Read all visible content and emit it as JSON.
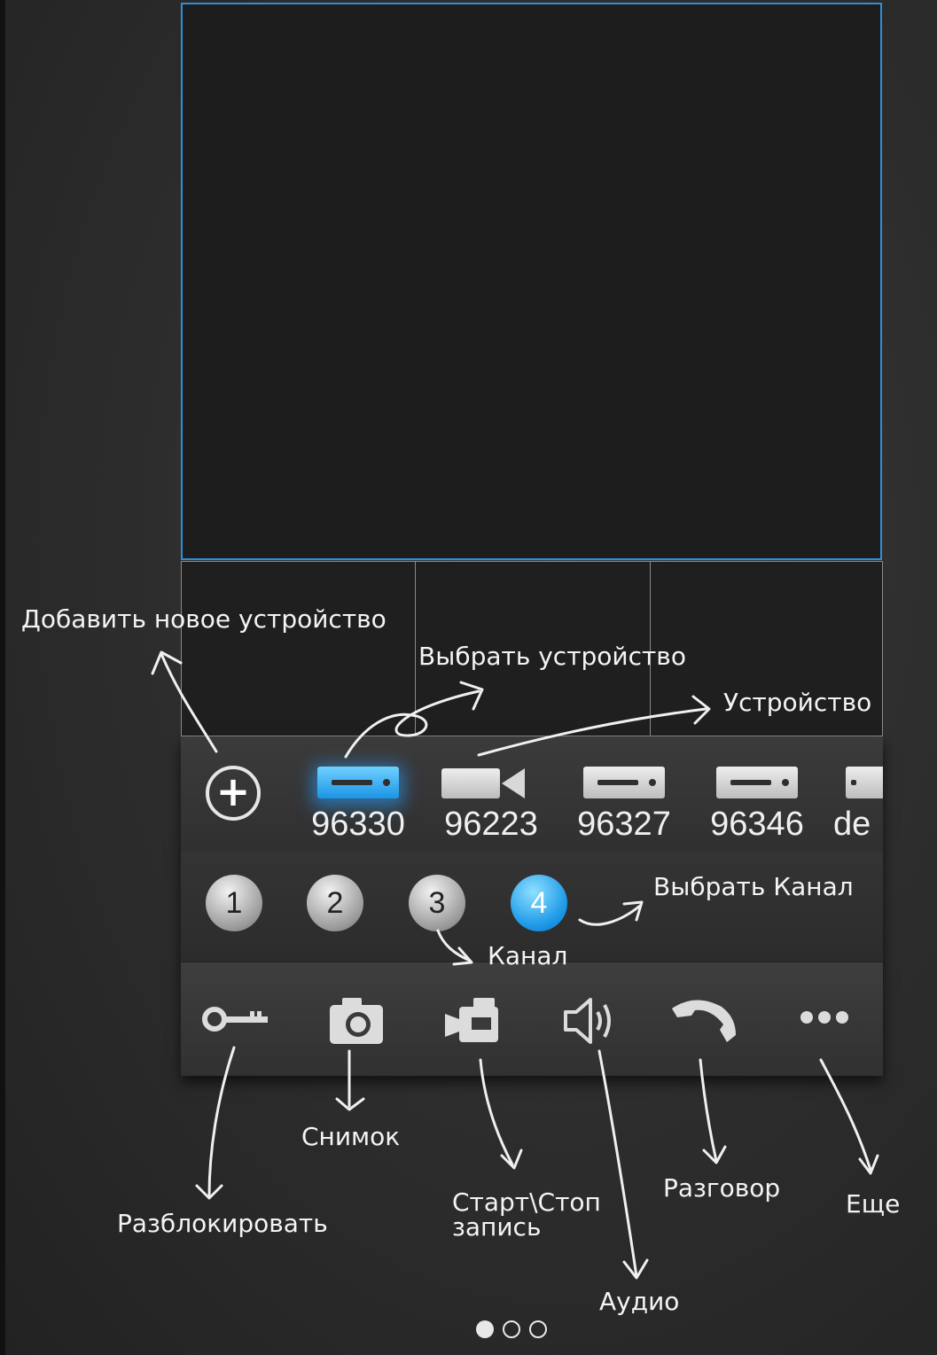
{
  "devices": [
    {
      "label": "96330",
      "icon": "dvr-icon",
      "active": true
    },
    {
      "label": "96223",
      "icon": "camera-icon",
      "active": false
    },
    {
      "label": "96327",
      "icon": "dvr-icon",
      "active": false
    },
    {
      "label": "96346",
      "icon": "dvr-icon",
      "active": false
    },
    {
      "label": "de",
      "icon": "dvr-icon",
      "active": false
    }
  ],
  "channels": [
    {
      "label": "1",
      "active": false
    },
    {
      "label": "2",
      "active": false
    },
    {
      "label": "3",
      "active": false
    },
    {
      "label": "4",
      "active": true
    }
  ],
  "toolbar_icons": [
    "key-icon",
    "camera-snapshot-icon",
    "video-record-icon",
    "speaker-icon",
    "phone-icon",
    "more-icon"
  ],
  "annotations": {
    "add_device": "Добавить новое устройство",
    "select_device": "Выбрать устройство",
    "device": "Устройство",
    "select_channel": "Выбрать Канал",
    "channel": "Канал",
    "unlock": "Разблокировать",
    "snapshot": "Снимок",
    "record_line1": "Старт\\Стоп",
    "record_line2": "запись",
    "audio": "Аудио",
    "talk": "Разговор",
    "more": "Еще"
  },
  "pager": {
    "total": 3,
    "current": 1
  },
  "colors": {
    "accent": "#2e8fd6",
    "active_blue": "#1e9ae8",
    "background": "#2c2c2c"
  }
}
